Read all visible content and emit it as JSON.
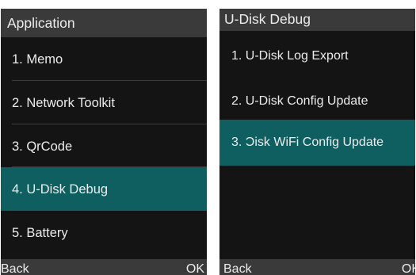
{
  "left_screen": {
    "title": "Application",
    "items": [
      {
        "label": "1. Memo",
        "selected": false
      },
      {
        "label": "2. Network Toolkit",
        "selected": false
      },
      {
        "label": "3. QrCode",
        "selected": false
      },
      {
        "label": "4. U-Disk Debug",
        "selected": true
      },
      {
        "label": "5. Battery",
        "selected": false
      }
    ],
    "softkeys": {
      "left": "Back",
      "right": "OK"
    }
  },
  "right_screen": {
    "title": "U-Disk Debug",
    "items": [
      {
        "label": "1. U-Disk Log Export",
        "selected": false
      },
      {
        "label": "2. U-Disk Config Update",
        "selected": false
      },
      {
        "label": "3. Ɔisk WiFi Config Update",
        "selected": true
      }
    ],
    "softkeys": {
      "left": "Back",
      "right": "OK"
    }
  },
  "colors": {
    "screen_background": "#141414",
    "bar_background": "#3a3a3a",
    "selected_highlight": "#0f5f60",
    "text": "#ececec"
  }
}
